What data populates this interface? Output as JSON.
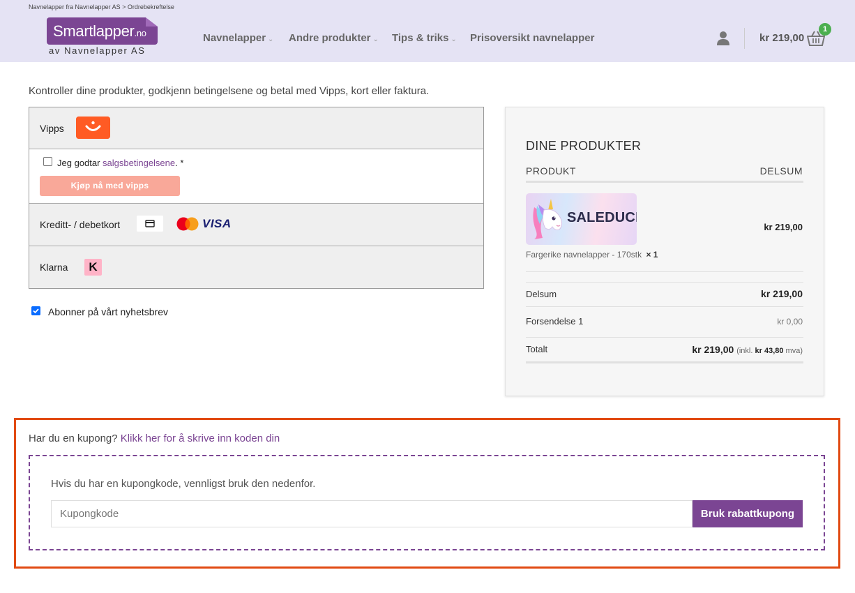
{
  "header": {
    "breadcrumb": "Navnelapper fra Navnelapper AS > Ordrebekreftelse",
    "logo_main": "Smartlapper",
    "logo_suffix": ".no",
    "logo_sub": "av Navnelapper AS",
    "nav": [
      {
        "label": "Navnelapper",
        "has_dropdown": true
      },
      {
        "label": "Andre produkter",
        "has_dropdown": true
      },
      {
        "label": "Tips & triks",
        "has_dropdown": true
      },
      {
        "label": "Prisoversikt navnelapper",
        "has_dropdown": false
      }
    ],
    "cart_total": "kr  219,00",
    "cart_count": "1",
    "icons": {
      "user": "user-icon",
      "cart": "basket-icon",
      "dropdown": "chevron-down-icon"
    }
  },
  "intro": "Kontroller dine produkter, godkjenn betingelsene og betal med Vipps, kort eller faktura.",
  "payment": {
    "vipps": {
      "label": "Vipps",
      "terms_prefix": "Jeg godtar ",
      "terms_link": "salgsbetingelsene",
      "terms_suffix": ". *",
      "terms_checked": false,
      "button": "Kjøp nå med vipps"
    },
    "card": {
      "label": "Kreditt- / debetkort",
      "brand": "VISA"
    },
    "klarna": {
      "label": "Klarna",
      "logo_letter": "K"
    }
  },
  "newsletter": {
    "label": "Abonner på vårt nyhetsbrev",
    "checked": true
  },
  "summary": {
    "title": "DINE PRODUKTER",
    "col_product": "PRODUKT",
    "col_total": "DELSUM",
    "item": {
      "image_text": "SALEDUCK",
      "name": "Fargerike navnelapper - 170stk",
      "qty": "× 1",
      "price": "kr  219,00"
    },
    "subtotal_label": "Delsum",
    "subtotal": "kr  219,00",
    "shipping_label": "Forsendelse 1",
    "shipping": "kr 0,00",
    "total_label": "Totalt",
    "total": "kr  219,00",
    "tax_prefix": "(inkl.",
    "tax_amount": "kr  43,80",
    "tax_suffix": "mva)"
  },
  "coupon": {
    "question": "Har du en kupong?",
    "link": "Klikk her for å skrive inn koden din",
    "instructions": "Hvis du har en kupongkode, vennligst bruk den nedenfor.",
    "placeholder": "Kupongkode",
    "button": "Bruk rabattkupong",
    "highlight_color": "#e14a12"
  },
  "colors": {
    "brand": "#7b4593",
    "header_bg": "#e5e3f4",
    "vipps": "#ff5b24",
    "badge": "#4caf50"
  }
}
